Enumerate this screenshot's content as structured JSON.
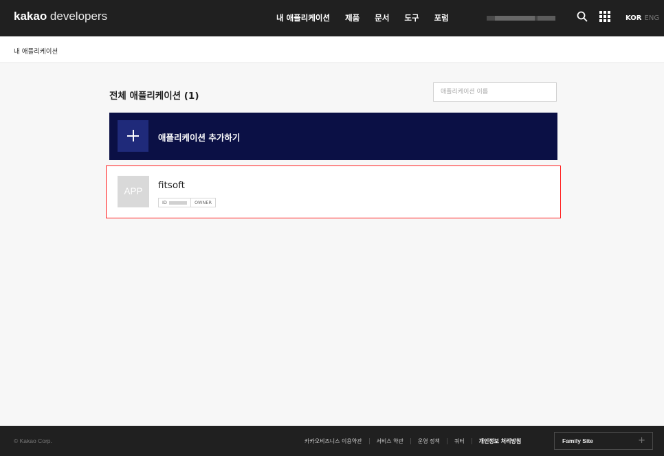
{
  "header": {
    "logo_bold": "kakao",
    "logo_light": " developers",
    "nav": [
      "내 애플리케이션",
      "제품",
      "문서",
      "도구",
      "포럼"
    ],
    "lang_kor": "KOR",
    "lang_eng": "ENG"
  },
  "breadcrumb": "내 애플리케이션",
  "main": {
    "title": "전체 애플리케이션 (1)",
    "search_placeholder": "애플리케이션 이름",
    "add_label": "애플리케이션 추가하기",
    "apps": [
      {
        "thumb": "APP",
        "name": "fitsoft",
        "id_label": "ID",
        "role": "OWNER"
      }
    ]
  },
  "footer": {
    "copyright": "© Kakao Corp.",
    "links": [
      "카카오비즈니스 이용약관",
      "서비스 약관",
      "운영 정책",
      "쿼터",
      "개인정보 처리방침"
    ],
    "family_site": "Family Site",
    "family_plus": "+"
  },
  "colors": {
    "header_bg": "#202020",
    "add_card_bg": "#0b1045",
    "selection_outline": "#ff1a1a"
  }
}
